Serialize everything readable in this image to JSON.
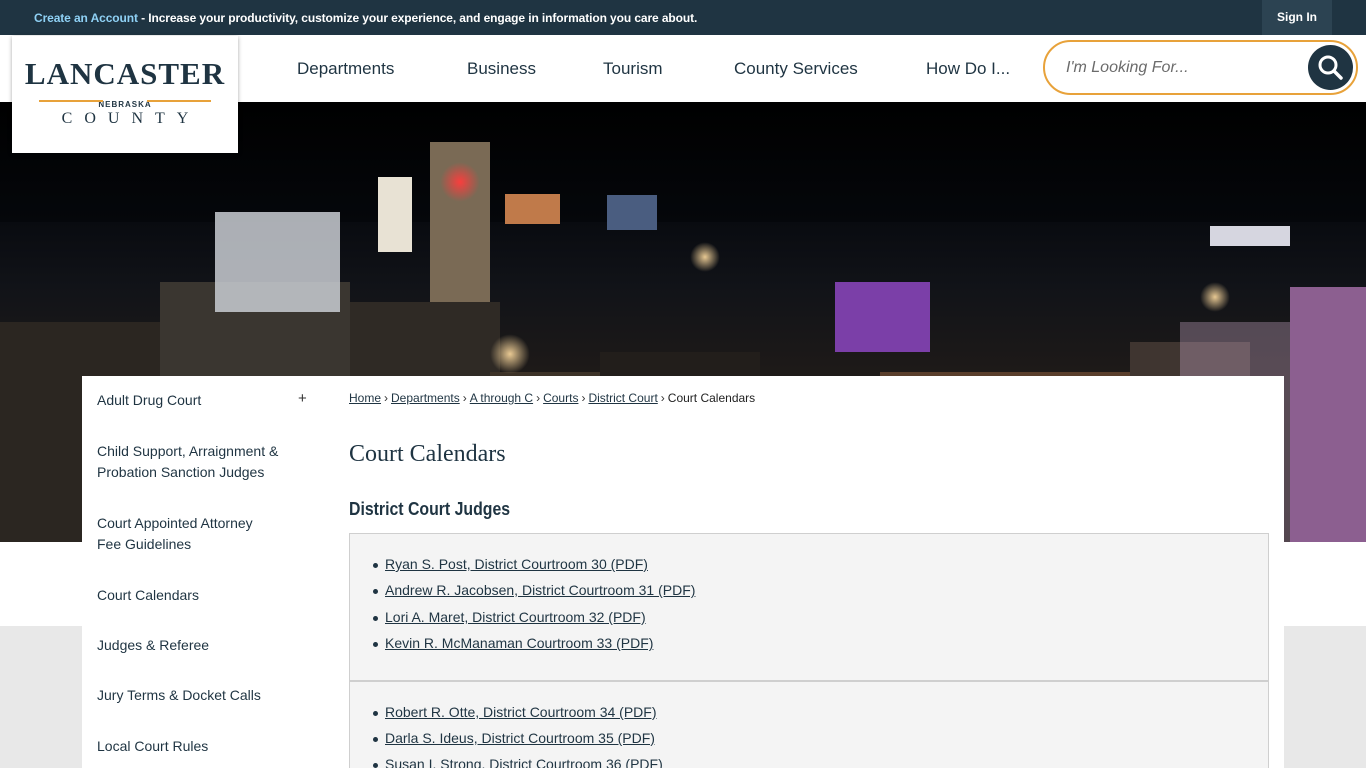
{
  "topbar": {
    "create_account": "Create an Account",
    "message": " - Increase your productivity, customize your experience, and engage in information you care about.",
    "sign_in": "Sign In"
  },
  "logo": {
    "line1": "LANCASTER",
    "line2": "NEBRASKA",
    "line3": "COUNTY"
  },
  "nav": {
    "items": [
      "Departments",
      "Business",
      "Tourism",
      "County Services",
      "How Do I..."
    ]
  },
  "search": {
    "placeholder": "I'm Looking For..."
  },
  "sidebar": {
    "items": [
      "Adult Drug Court",
      "Child Support, Arraignment & Probation Sanction Judges",
      "Court Appointed Attorney Fee Guidelines",
      "Court Calendars",
      "Judges & Referee",
      "Jury Terms & Docket Calls",
      "Local Court Rules"
    ],
    "expand_symbol": "+"
  },
  "breadcrumb": {
    "items": [
      "Home",
      "Departments",
      "A through C",
      "Courts",
      "District Court"
    ],
    "current": "Court Calendars",
    "separator": "›"
  },
  "page": {
    "title": "Court Calendars",
    "subtitle": "District Court Judges"
  },
  "panels": {
    "first": [
      "Ryan S. Post, District Courtroom 30 (PDF)",
      "Andrew R. Jacobsen, District Courtroom 31 (PDF)",
      "Lori A. Maret, District Courtroom 32 (PDF)",
      "Kevin R. McManaman Courtroom 33 (PDF)"
    ],
    "second": [
      "Robert R. Otte, District Courtroom 34 (PDF)",
      "Darla S. Ideus, District Courtroom 35 (PDF)",
      "Susan I. Strong, District Courtroom 36 (PDF)"
    ]
  },
  "colors": {
    "brand_navy": "#1f3442",
    "accent_orange": "#e8a23a",
    "link_blue": "#8fd1f5"
  }
}
